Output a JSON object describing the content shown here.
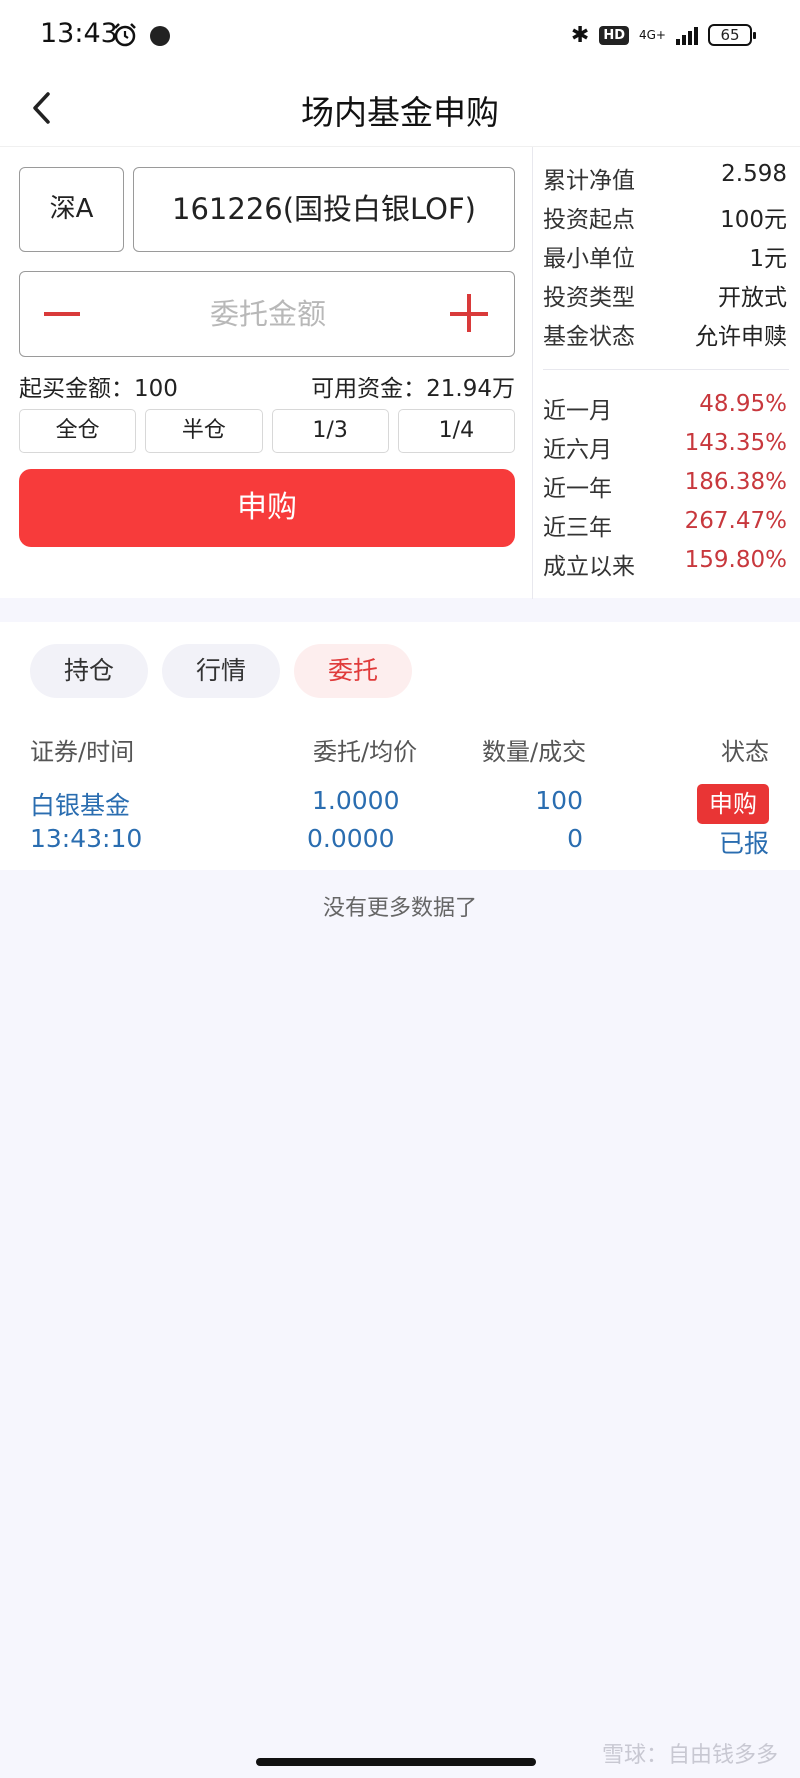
{
  "status_bar": {
    "time": "13:43",
    "network": "4G+",
    "hd": "HD",
    "battery": "65"
  },
  "nav": {
    "title": "场内基金申购"
  },
  "order": {
    "market": "深A",
    "fund": "161226(国投白银LOF)",
    "amount_placeholder": "委托金额",
    "min_buy_label": "起买金额：",
    "min_buy_value": "100",
    "available_label": "可用资金：",
    "available_value": "21.94万",
    "ratios": [
      "全仓",
      "半仓",
      "1/3",
      "1/4"
    ],
    "submit_label": "申购"
  },
  "fund_info": {
    "attributes": [
      {
        "label": "累计净值",
        "value": "2.598"
      },
      {
        "label": "投资起点",
        "value": "100元"
      },
      {
        "label": "最小单位",
        "value": "1元"
      },
      {
        "label": "投资类型",
        "value": "开放式"
      },
      {
        "label": "基金状态",
        "value": "允许申赎"
      }
    ],
    "returns": [
      {
        "label": "近一月",
        "value": "48.95%"
      },
      {
        "label": "近六月",
        "value": "143.35%"
      },
      {
        "label": "近一年",
        "value": "186.38%"
      },
      {
        "label": "近三年",
        "value": "267.47%"
      },
      {
        "label": "成立以来",
        "value": "159.80%"
      }
    ]
  },
  "tabs": [
    {
      "label": "持仓",
      "active": false
    },
    {
      "label": "行情",
      "active": false
    },
    {
      "label": "委托",
      "active": true
    }
  ],
  "table": {
    "headers": [
      "证券/时间",
      "委托/均价",
      "数量/成交",
      "状态"
    ],
    "rows": [
      {
        "name": "白银基金",
        "time": "13:43:10",
        "price": "1.0000",
        "avg_price": "0.0000",
        "quantity": "100",
        "filled": "0",
        "type_badge": "申购",
        "status": "已报"
      }
    ]
  },
  "empty_text": "没有更多数据了",
  "watermark": "雪球：自由钱多多",
  "colors": {
    "accent_red": "#f73b3b",
    "return_red": "#c8383d",
    "link_blue": "#2a6db0",
    "page_bg": "#f6f6fd"
  }
}
